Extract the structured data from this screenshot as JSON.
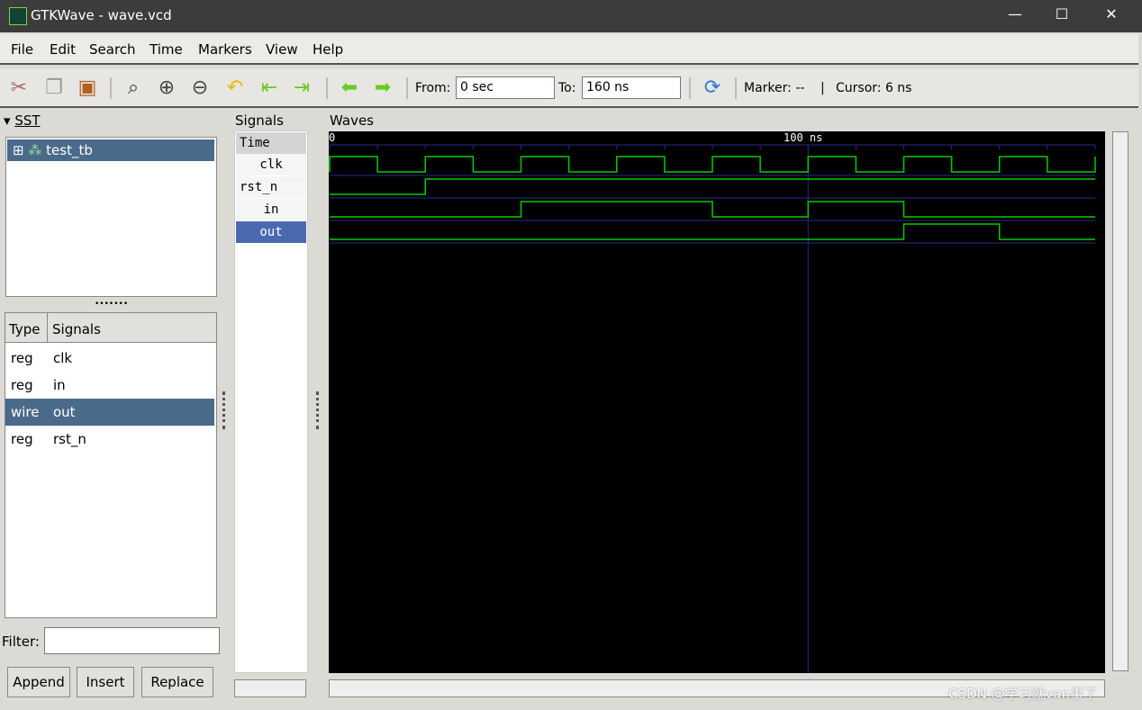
{
  "window": {
    "title": "GTKWave - wave.vcd",
    "minimize": "—",
    "maximize": "☐",
    "close": "✕"
  },
  "menu": [
    "File",
    "Edit",
    "Search",
    "Time",
    "Markers",
    "View",
    "Help"
  ],
  "toolbar": {
    "from_label": "From:",
    "from_value": "0 sec",
    "to_label": "To:",
    "to_value": "160 ns",
    "marker": "Marker: --",
    "divider": "|",
    "cursor": "Cursor: 6 ns"
  },
  "sst": {
    "title": "SST",
    "tree_root": "test_tb",
    "columns": [
      "Type",
      "Signals"
    ],
    "rows": [
      {
        "type": "reg",
        "name": "clk"
      },
      {
        "type": "reg",
        "name": "in"
      },
      {
        "type": "wire",
        "name": "out",
        "selected": true
      },
      {
        "type": "reg",
        "name": "rst_n"
      }
    ],
    "filter_label": "Filter:",
    "filter_value": "",
    "buttons": [
      "Append",
      "Insert",
      "Replace"
    ]
  },
  "signals": {
    "title": "Signals",
    "header": "Time",
    "items": [
      "clk",
      "rst_n",
      "in",
      "out"
    ],
    "selected": "out"
  },
  "waves": {
    "title": "Waves",
    "start_label": "0",
    "marker_label": "100 ns",
    "range_ns": [
      0,
      160
    ],
    "tick_ns": 10,
    "cursor_ns": 100,
    "wave_color": "#00cc00",
    "grid_color": "#2a2a90",
    "traces": [
      {
        "name": "clk",
        "edges": [
          [
            0,
            1
          ],
          [
            10,
            0
          ],
          [
            20,
            1
          ],
          [
            30,
            0
          ],
          [
            40,
            1
          ],
          [
            50,
            0
          ],
          [
            60,
            1
          ],
          [
            70,
            0
          ],
          [
            80,
            1
          ],
          [
            90,
            0
          ],
          [
            100,
            1
          ],
          [
            110,
            0
          ],
          [
            120,
            1
          ],
          [
            130,
            0
          ],
          [
            140,
            1
          ],
          [
            150,
            0
          ],
          [
            160,
            1
          ]
        ]
      },
      {
        "name": "rst_n",
        "edges": [
          [
            0,
            0
          ],
          [
            20,
            1
          ]
        ]
      },
      {
        "name": "in",
        "edges": [
          [
            0,
            0
          ],
          [
            40,
            1
          ],
          [
            80,
            0
          ],
          [
            100,
            1
          ],
          [
            120,
            0
          ]
        ]
      },
      {
        "name": "out",
        "edges": [
          [
            0,
            0
          ],
          [
            120,
            1
          ],
          [
            140,
            0
          ]
        ]
      }
    ]
  },
  "watermark": "CSDN @学习就van事了",
  "colors": {
    "selection": "#4a6a8a",
    "signal_selection": "#4a6ab0"
  }
}
